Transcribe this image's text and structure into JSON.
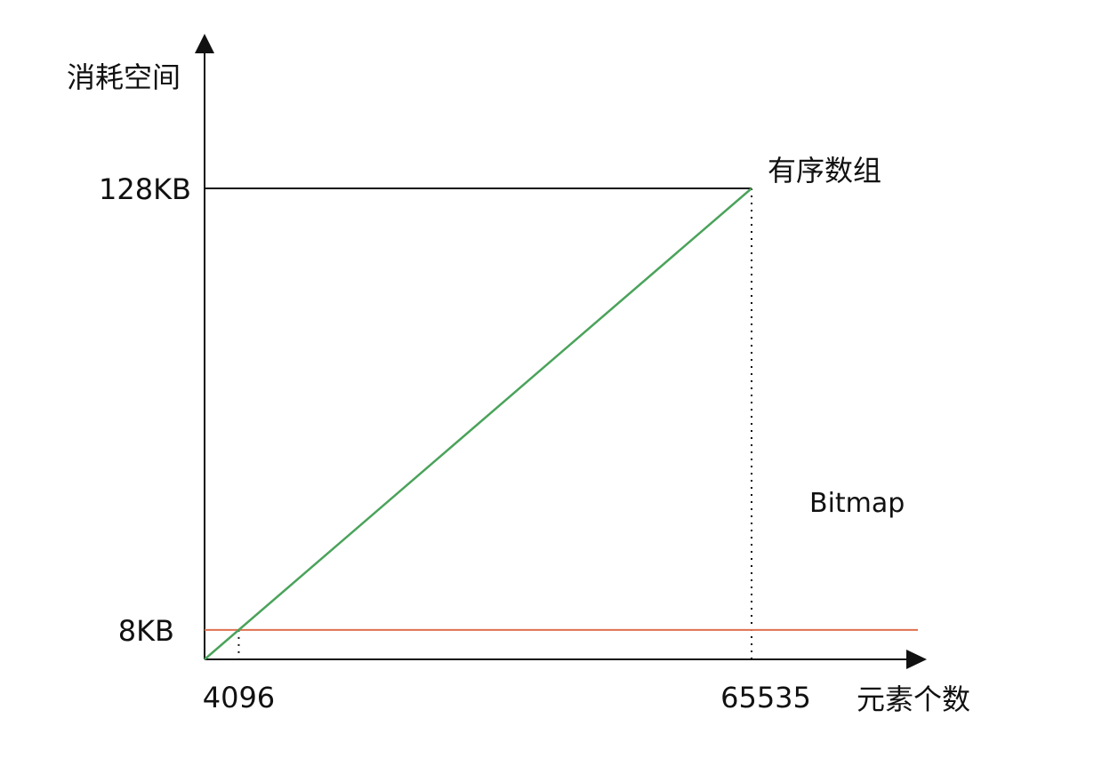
{
  "chart_data": {
    "type": "line",
    "title": "",
    "xlabel": "元素个数",
    "ylabel": "消耗空间",
    "xlim": [
      0,
      68000
    ],
    "ylim_kb": [
      0,
      131
    ],
    "x_ticks": [
      {
        "value": 4096,
        "label": "4096"
      },
      {
        "value": 65535,
        "label": "65535"
      }
    ],
    "y_ticks": [
      {
        "value": 8,
        "label": "8KB"
      },
      {
        "value": 128,
        "label": "128KB"
      }
    ],
    "series": [
      {
        "name": "有序数组",
        "color": "#4aa35a",
        "points": [
          [
            0,
            0
          ],
          [
            65535,
            128
          ]
        ]
      },
      {
        "name": "Bitmap",
        "color": "#e0704f",
        "points": [
          [
            0,
            8
          ],
          [
            68000,
            8
          ]
        ]
      }
    ],
    "reference_lines": [
      {
        "type": "horizontal",
        "y": 128,
        "x_end": 65535,
        "style": "solid",
        "color": "#111111"
      },
      {
        "type": "vertical",
        "x": 4096,
        "y_end": 8,
        "style": "dotted",
        "color": "#111111"
      },
      {
        "type": "vertical",
        "x": 65535,
        "y_end": 128,
        "style": "dotted",
        "color": "#111111"
      }
    ],
    "grid": false,
    "legend": "inline-labels"
  }
}
